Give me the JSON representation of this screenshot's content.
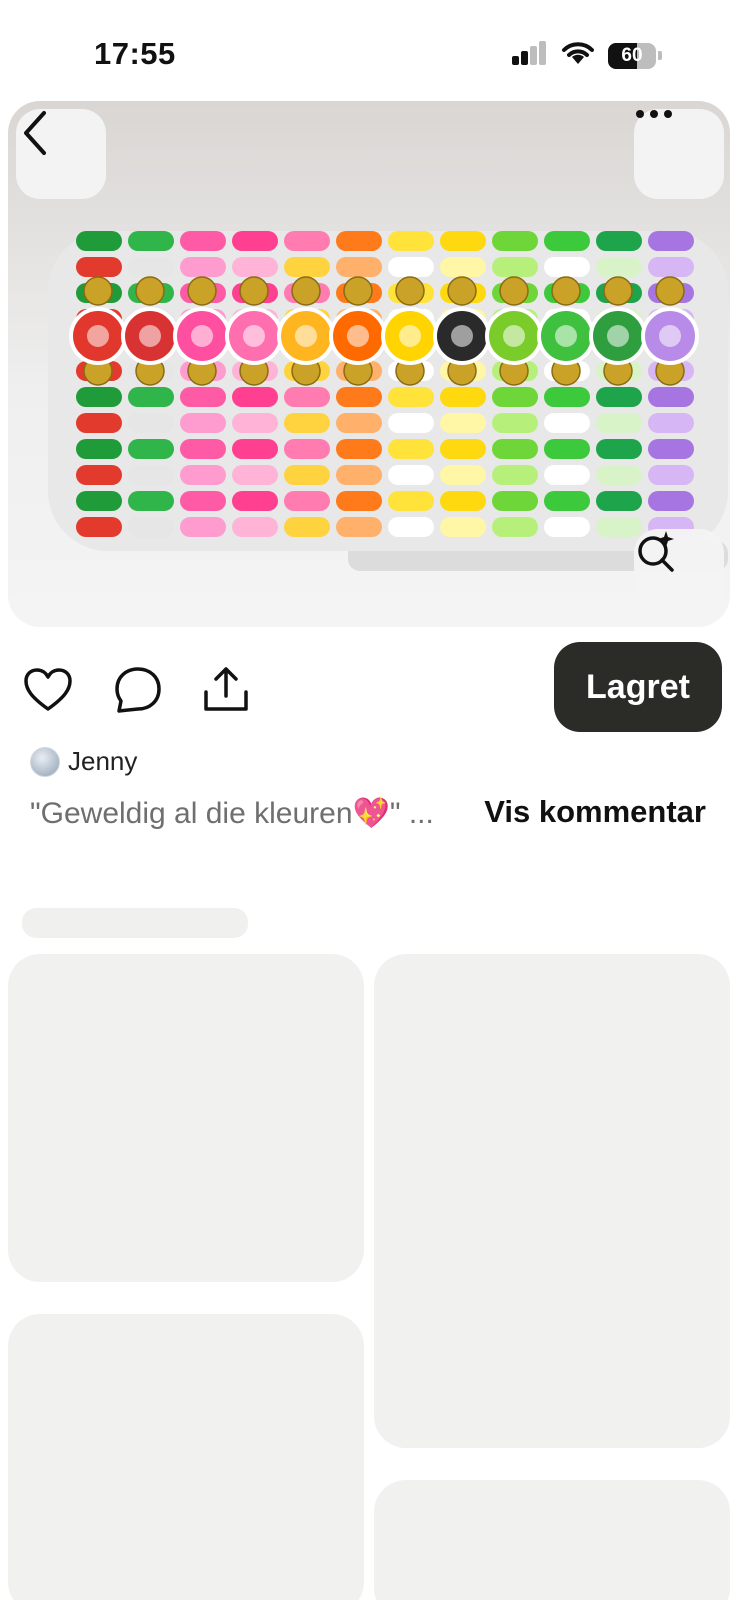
{
  "status_bar": {
    "time": "17:55",
    "battery_level": "60"
  },
  "hero": {
    "alt": "Colorful fruit clay-bead bracelets",
    "icons": [
      "back-arrow-icon",
      "more-icon",
      "visual-search-icon"
    ]
  },
  "actions": {
    "icons": [
      "heart-icon",
      "comment-icon",
      "share-icon"
    ],
    "saved_label": "Lagret"
  },
  "comment": {
    "author": "Jenny",
    "text": "\"Geweldig al die kleuren💖\" ...",
    "see_comments_label": "Vis kommentar"
  },
  "colors": {
    "saved_button_bg": "#2b2b28",
    "skeleton": "#f1f1f0"
  }
}
